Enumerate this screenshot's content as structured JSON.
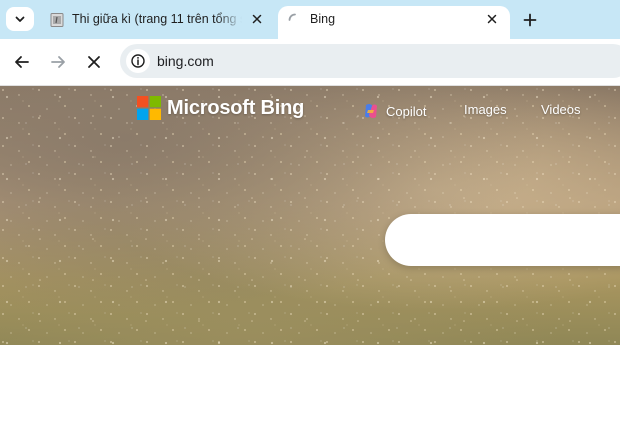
{
  "browser": {
    "tabs": [
      {
        "title": "Thi giữa kì (trang 11 trên tổng số",
        "active": false,
        "favicon": "pdf-file-icon"
      },
      {
        "title": "Bing",
        "active": true,
        "favicon": "loading-spinner-icon"
      }
    ],
    "address": {
      "url": "bing.com"
    },
    "colors": {
      "tabstrip": "#c7e7f6",
      "omnibox": "#e9eef1"
    }
  },
  "bing": {
    "brand": "Microsoft Bing",
    "nav": {
      "copilot": "Copilot",
      "images": "Images",
      "videos": "Videos"
    },
    "colors": {
      "ms_red": "#f25022",
      "ms_green": "#7fba00",
      "ms_blue": "#00a4ef",
      "ms_yellow": "#ffb900"
    }
  }
}
